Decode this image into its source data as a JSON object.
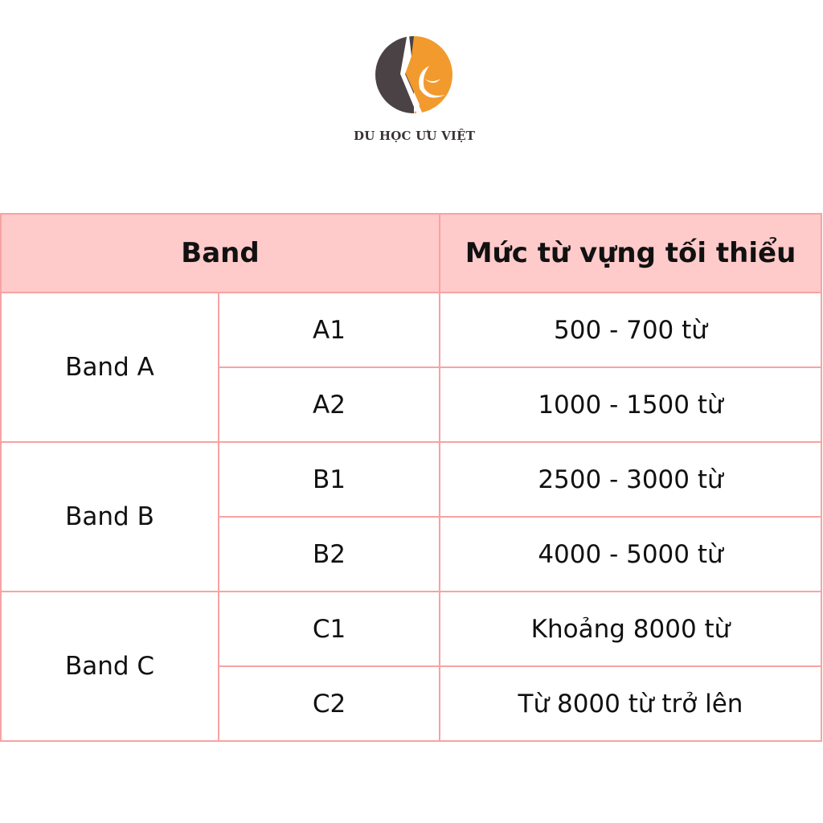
{
  "logo": {
    "brand_name": "DU HỌC ƯU VIỆT",
    "icon": "circle-logo-icon",
    "colors": {
      "orange": "#f29a2e",
      "dark": "#4a4244"
    }
  },
  "table": {
    "headers": {
      "band": "Band",
      "vocab": "Mức từ vựng tối thiểu"
    },
    "colors": {
      "border": "#f7a3a3",
      "header_bg": "#ffcaca"
    },
    "groups": [
      {
        "band": "Band A",
        "levels": [
          {
            "level": "A1",
            "vocab": "500 - 700 từ"
          },
          {
            "level": "A2",
            "vocab": "1000 - 1500 từ"
          }
        ]
      },
      {
        "band": "Band B",
        "levels": [
          {
            "level": "B1",
            "vocab": "2500 - 3000 từ"
          },
          {
            "level": "B2",
            "vocab": "4000 - 5000 từ"
          }
        ]
      },
      {
        "band": "Band C",
        "levels": [
          {
            "level": "C1",
            "vocab": "Khoảng 8000 từ"
          },
          {
            "level": "C2",
            "vocab": "Từ 8000 từ trở lên"
          }
        ]
      }
    ]
  }
}
